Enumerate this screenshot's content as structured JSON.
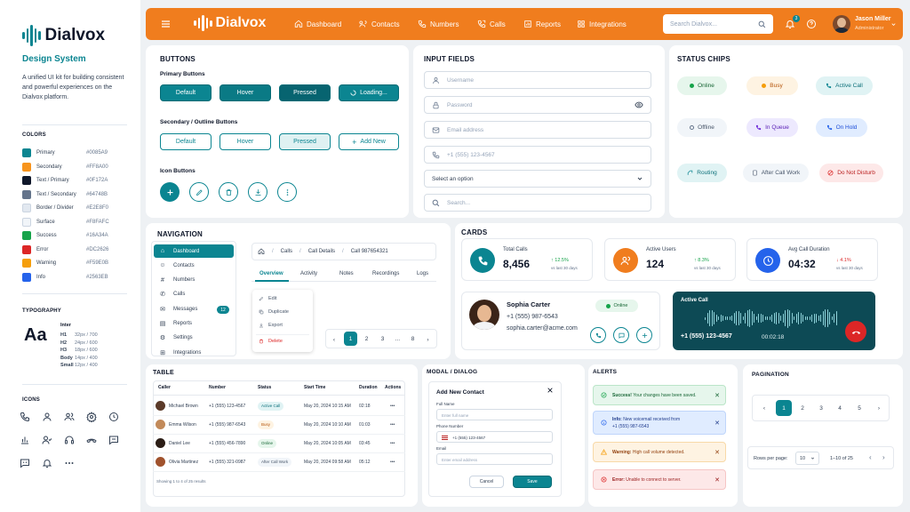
{
  "brand": {
    "name": "Dialvox",
    "subtitle": "Design System",
    "description": "A unified UI kit for building consistent and powerful experiences on the Dialvox platform."
  },
  "colors": {
    "title": "COLORS",
    "items": [
      {
        "name": "Primary",
        "hex": "#0085A9",
        "swatch": "#0b8591"
      },
      {
        "name": "Secondary",
        "hex": "#FF8A00",
        "swatch": "#f7941d"
      },
      {
        "name": "Text / Primary",
        "hex": "#0F172A",
        "swatch": "#0f172a"
      },
      {
        "name": "Text / Secondary",
        "hex": "#64748B",
        "swatch": "#64748b"
      },
      {
        "name": "Border / Divider",
        "hex": "#E2E8F0",
        "swatch": "#e2e8f0"
      },
      {
        "name": "Surface",
        "hex": "#F8FAFC",
        "swatch": "#f1f5f9"
      },
      {
        "name": "Success",
        "hex": "#16A34A",
        "swatch": "#16a34a"
      },
      {
        "name": "Error",
        "hex": "#DC2626",
        "swatch": "#dc2626"
      },
      {
        "name": "Warning",
        "hex": "#F59E0B",
        "swatch": "#f59e0b"
      },
      {
        "name": "Info",
        "hex": "#2563EB",
        "swatch": "#2563eb"
      }
    ]
  },
  "typography": {
    "title": "TYPOGRAPHY",
    "sample": "Aa",
    "font": "Inter",
    "scale": [
      {
        "k": "H1",
        "v": "32px / 700"
      },
      {
        "k": "H2",
        "v": "24px / 600"
      },
      {
        "k": "H3",
        "v": "18px / 600"
      },
      {
        "k": "Body",
        "v": "14px / 400"
      },
      {
        "k": "Small",
        "v": "12px / 400"
      }
    ]
  },
  "icons": {
    "title": "ICONS"
  },
  "header": {
    "brand": "Dialvox",
    "nav": [
      "Dashboard",
      "Contacts",
      "Numbers",
      "Calls",
      "Reports",
      "Integrations"
    ],
    "search_placeholder": "Search Dialvox...",
    "notif_count": "3",
    "user_name": "Jason Miller",
    "user_role": "Administrator"
  },
  "buttons": {
    "title": "BUTTONS",
    "primary_label": "Primary Buttons",
    "primary": [
      "Default",
      "Hover",
      "Pressed",
      "Loading..."
    ],
    "secondary_label": "Secondary / Outline Buttons",
    "secondary": [
      "Default",
      "Hover",
      "Pressed",
      "Add New"
    ],
    "icon_label": "Icon Buttons"
  },
  "inputs": {
    "title": "INPUT FIELDS",
    "fields": [
      "Username",
      "Password",
      "Email address",
      "+1 (555) 123-4567",
      "Select an option",
      "Search..."
    ]
  },
  "chips": {
    "title": "STATUS CHIPS",
    "items": [
      "Online",
      "Busy",
      "Active Call",
      "Offline",
      "In Queue",
      "On Hold",
      "Routing",
      "After Call Work",
      "Do Not Disturb"
    ]
  },
  "navigation": {
    "title": "NAVIGATION",
    "items": [
      "Dashboard",
      "Contacts",
      "Numbers",
      "Calls",
      "Messages",
      "Reports",
      "Settings",
      "Integrations"
    ],
    "messages_badge": "12",
    "breadcrumb": [
      "Calls",
      "Call Details",
      "Call 987654321"
    ],
    "tabs": [
      "Overview",
      "Activity",
      "Notes",
      "Recordings",
      "Logs"
    ],
    "menu": [
      "Edit",
      "Duplicate",
      "Export",
      "Delete"
    ],
    "pages": [
      "1",
      "2",
      "3",
      "...",
      "8"
    ]
  },
  "cards": {
    "title": "CARDS",
    "stats": [
      {
        "label": "Total Calls",
        "value": "8,456",
        "delta": "↑ 12.5%",
        "note": "vs last 30 days"
      },
      {
        "label": "Active Users",
        "value": "124",
        "delta": "↑ 8.3%",
        "note": "vs last 30 days"
      },
      {
        "label": "Avg Call Duration",
        "value": "04:32",
        "delta": "↓ 4.1%",
        "note": "vs last 30 days"
      }
    ],
    "contact": {
      "name": "Sophia Carter",
      "phone": "+1 (555) 987-6543",
      "email": "sophia.carter@acme.com",
      "status": "Online"
    },
    "active_call": {
      "title": "Active Call",
      "number": "+1 (555) 123-4567",
      "time": "00:02:18"
    }
  },
  "table": {
    "title": "TABLE",
    "headers": [
      "Caller",
      "Number",
      "Status",
      "Start Time",
      "Duration",
      "Actions"
    ],
    "rows": [
      {
        "name": "Michael Brown",
        "number": "+1 (555) 123-4567",
        "status": "Active Call",
        "start": "May 20, 2024 10:15 AM",
        "dur": "02:18",
        "act": "•••"
      },
      {
        "name": "Emma Wilson",
        "number": "+1 (555) 987-6543",
        "status": "Busy",
        "start": "May 20, 2024 10:10 AM",
        "dur": "01:03",
        "act": "•••"
      },
      {
        "name": "Daniel Lee",
        "number": "+1 (555) 456-7890",
        "status": "Online",
        "start": "May 20, 2024 10:05 AM",
        "dur": "03:45",
        "act": "•••"
      },
      {
        "name": "Olivia Martinez",
        "number": "+1 (555) 321-0987",
        "status": "After Call Work",
        "start": "May 20, 2024 09:58 AM",
        "dur": "05:12",
        "act": "•••"
      }
    ],
    "footer": "Showing 1 to 4 of 25 results"
  },
  "modal": {
    "title": "MODAL / DIALOG",
    "heading": "Add New Contact",
    "full_name_label": "Full Name",
    "full_name_ph": "Enter full name",
    "phone_label": "Phone Number",
    "phone_value": "+1 (555) 123-4567",
    "email_label": "Email",
    "email_ph": "Enter email address",
    "cancel": "Cancel",
    "save": "Save"
  },
  "alerts": {
    "title": "ALERTS",
    "items": [
      {
        "strong": "Success!",
        "text": "Your changes have been saved."
      },
      {
        "strong": "Info:",
        "text": "New voicemail received from",
        "text2": "+1 (555) 987-6543"
      },
      {
        "strong": "Warning:",
        "text": "High call volume detected."
      },
      {
        "strong": "Error:",
        "text": "Unable to connect to server."
      }
    ]
  },
  "pagination": {
    "title": "PAGINATION",
    "pages": [
      "1",
      "2",
      "3",
      "4",
      "5"
    ],
    "rows_label": "Rows per page:",
    "rows_value": "10",
    "range": "1–10 of 25"
  }
}
